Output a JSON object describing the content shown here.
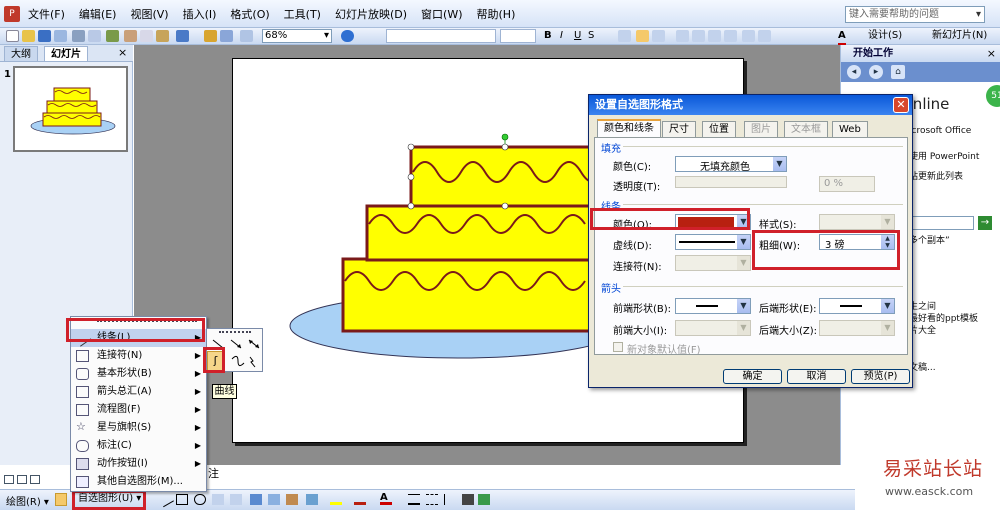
{
  "menubar": {
    "items": [
      "文件(F)",
      "编辑(E)",
      "视图(V)",
      "插入(I)",
      "格式(O)",
      "工具(T)",
      "幻灯片放映(D)",
      "窗口(W)",
      "帮助(H)"
    ],
    "help_placeholder": "键入需要帮助的问题"
  },
  "toolbar": {
    "zoom": "68%",
    "design_label": "设计(S)",
    "new_slide_label": "新幻灯片(N)"
  },
  "left_panel": {
    "tab_outline": "大纲",
    "tab_slides": "幻灯片",
    "close": "×",
    "slide_number": "1"
  },
  "right_panel": {
    "title": "开始工作",
    "close": "×",
    "office_text": "Online",
    "badge": "51",
    "lines": [
      "icrosoft Office",
      "使用 PowerPoint",
      "站更新此列表",
      "多个副本”",
      "生之间",
      "最好看的ppt模板",
      "片大全",
      "文稿..."
    ]
  },
  "status": {
    "notes_text": "注"
  },
  "drawbar": {
    "draw_label": "绘图(R) ▾",
    "autoshapes_label": "自选图形(U) ▾"
  },
  "autoshapes_menu": {
    "items": [
      {
        "label": "线条(L)",
        "arrow": "▶"
      },
      {
        "label": "连接符(N)",
        "arrow": "▶"
      },
      {
        "label": "基本形状(B)",
        "arrow": "▶"
      },
      {
        "label": "箭头总汇(A)",
        "arrow": "▶"
      },
      {
        "label": "流程图(F)",
        "arrow": "▶"
      },
      {
        "label": "星与旗帜(S)",
        "arrow": "▶"
      },
      {
        "label": "标注(C)",
        "arrow": "▶"
      },
      {
        "label": "动作按钮(I)",
        "arrow": "▶"
      },
      {
        "label": "其他自选图形(M)...",
        "arrow": ""
      }
    ]
  },
  "tooltip": "曲线",
  "dialog": {
    "title": "设置自选图形格式",
    "close": "✕",
    "tabs": [
      "颜色和线条",
      "尺寸",
      "位置",
      "图片",
      "文本框",
      "Web"
    ],
    "fill_section": "填充",
    "fill_color_label": "颜色(C):",
    "fill_color_value": "无填充颜色",
    "transparency_label": "透明度(T):",
    "transparency_value": "0 %",
    "line_section": "线条",
    "line_color_label": "颜色(O):",
    "line_style_label": "样式(S):",
    "dash_label": "虚线(D):",
    "weight_label": "粗细(W):",
    "weight_value": "3 磅",
    "connector_label": "连接符(N):",
    "arrows_section": "箭头",
    "begin_style_label": "前端形状(B):",
    "end_style_label": "后端形状(E):",
    "begin_size_label": "前端大小(I):",
    "end_size_label": "后端大小(Z):",
    "default_checkbox": "新对象默认值(F)",
    "ok": "确定",
    "cancel": "取消",
    "preview": "预览(P)",
    "line_color_hex": "#b82010"
  },
  "watermark": {
    "big": "易采站长站",
    "url": "www.easck.com"
  },
  "colors": {
    "cake": "#ffff00",
    "cake_border": "#7a1a1a",
    "plate": "#a9d1f5",
    "highlight": "#d0202a"
  }
}
